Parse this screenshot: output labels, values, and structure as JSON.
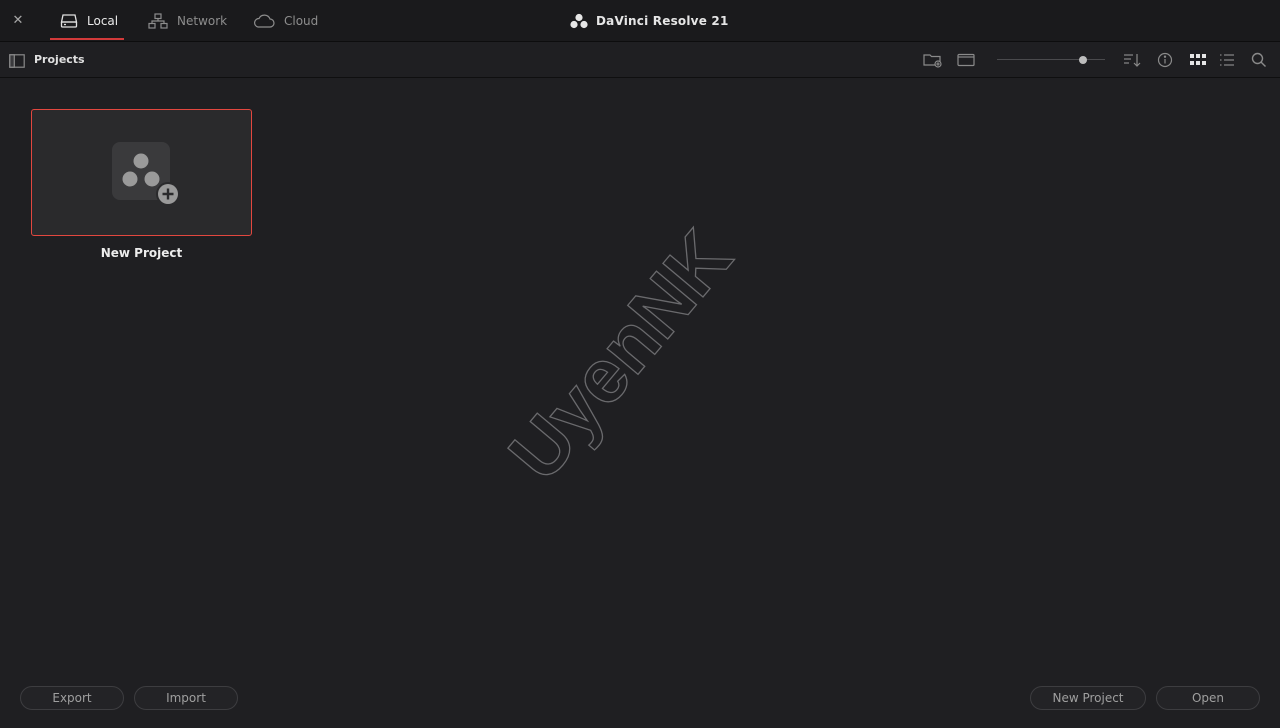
{
  "window": {
    "title": "DaVinci Resolve 21",
    "tabs": [
      {
        "label": "Local",
        "icon": "drive-icon",
        "active": true
      },
      {
        "label": "Network",
        "icon": "network-icon",
        "active": false
      },
      {
        "label": "Cloud",
        "icon": "cloud-icon",
        "active": false
      }
    ]
  },
  "toolbar": {
    "title": "Projects",
    "zoom_level": 0.8,
    "icons": [
      "new-folder-icon",
      "bin-icon",
      "sort-icon",
      "info-icon",
      "grid-view-icon",
      "list-view-icon",
      "search-icon"
    ]
  },
  "projects": [
    {
      "label": "New Project",
      "icon": "new-project-icon",
      "selected": true
    }
  ],
  "footer": {
    "export_label": "Export",
    "import_label": "Import",
    "new_project_label": "New Project",
    "open_label": "Open"
  },
  "watermark": "UyenNK",
  "colors": {
    "accent": "#d23a3a",
    "selection_border": "#e2473f",
    "background": "#1f1f22",
    "topbar": "#1a1a1c"
  }
}
